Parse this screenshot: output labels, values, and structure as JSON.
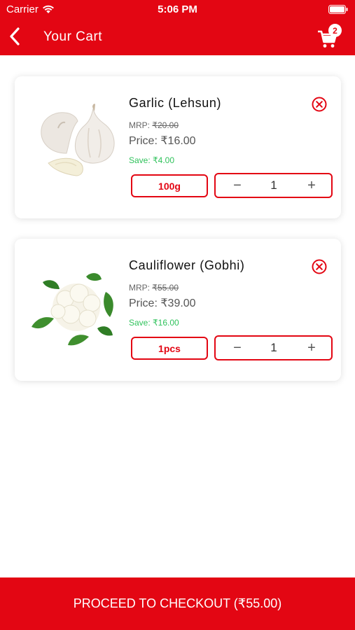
{
  "status_bar": {
    "carrier": "Carrier",
    "time": "5:06 PM"
  },
  "header": {
    "title": "Your Cart",
    "cart_count": "2"
  },
  "labels": {
    "mrp_prefix": "MRP:",
    "price_prefix": "Price:",
    "save_prefix": "Save:"
  },
  "cart": {
    "items": [
      {
        "name": "Garlic (Lehsun)",
        "mrp": "₹20.00",
        "price": "₹16.00",
        "save": "₹4.00",
        "unit": "100g",
        "quantity": "1",
        "image_icon": "garlic-image"
      },
      {
        "name": "Cauliflower (Gobhi)",
        "mrp": "₹55.00",
        "price": "₹39.00",
        "save": "₹16.00",
        "unit": "1pcs",
        "quantity": "1",
        "image_icon": "cauliflower-image"
      }
    ]
  },
  "checkout": {
    "label": "PROCEED TO CHECKOUT (₹55.00)"
  },
  "colors": {
    "brand": "#e30613",
    "save_green": "#2fc25b"
  }
}
